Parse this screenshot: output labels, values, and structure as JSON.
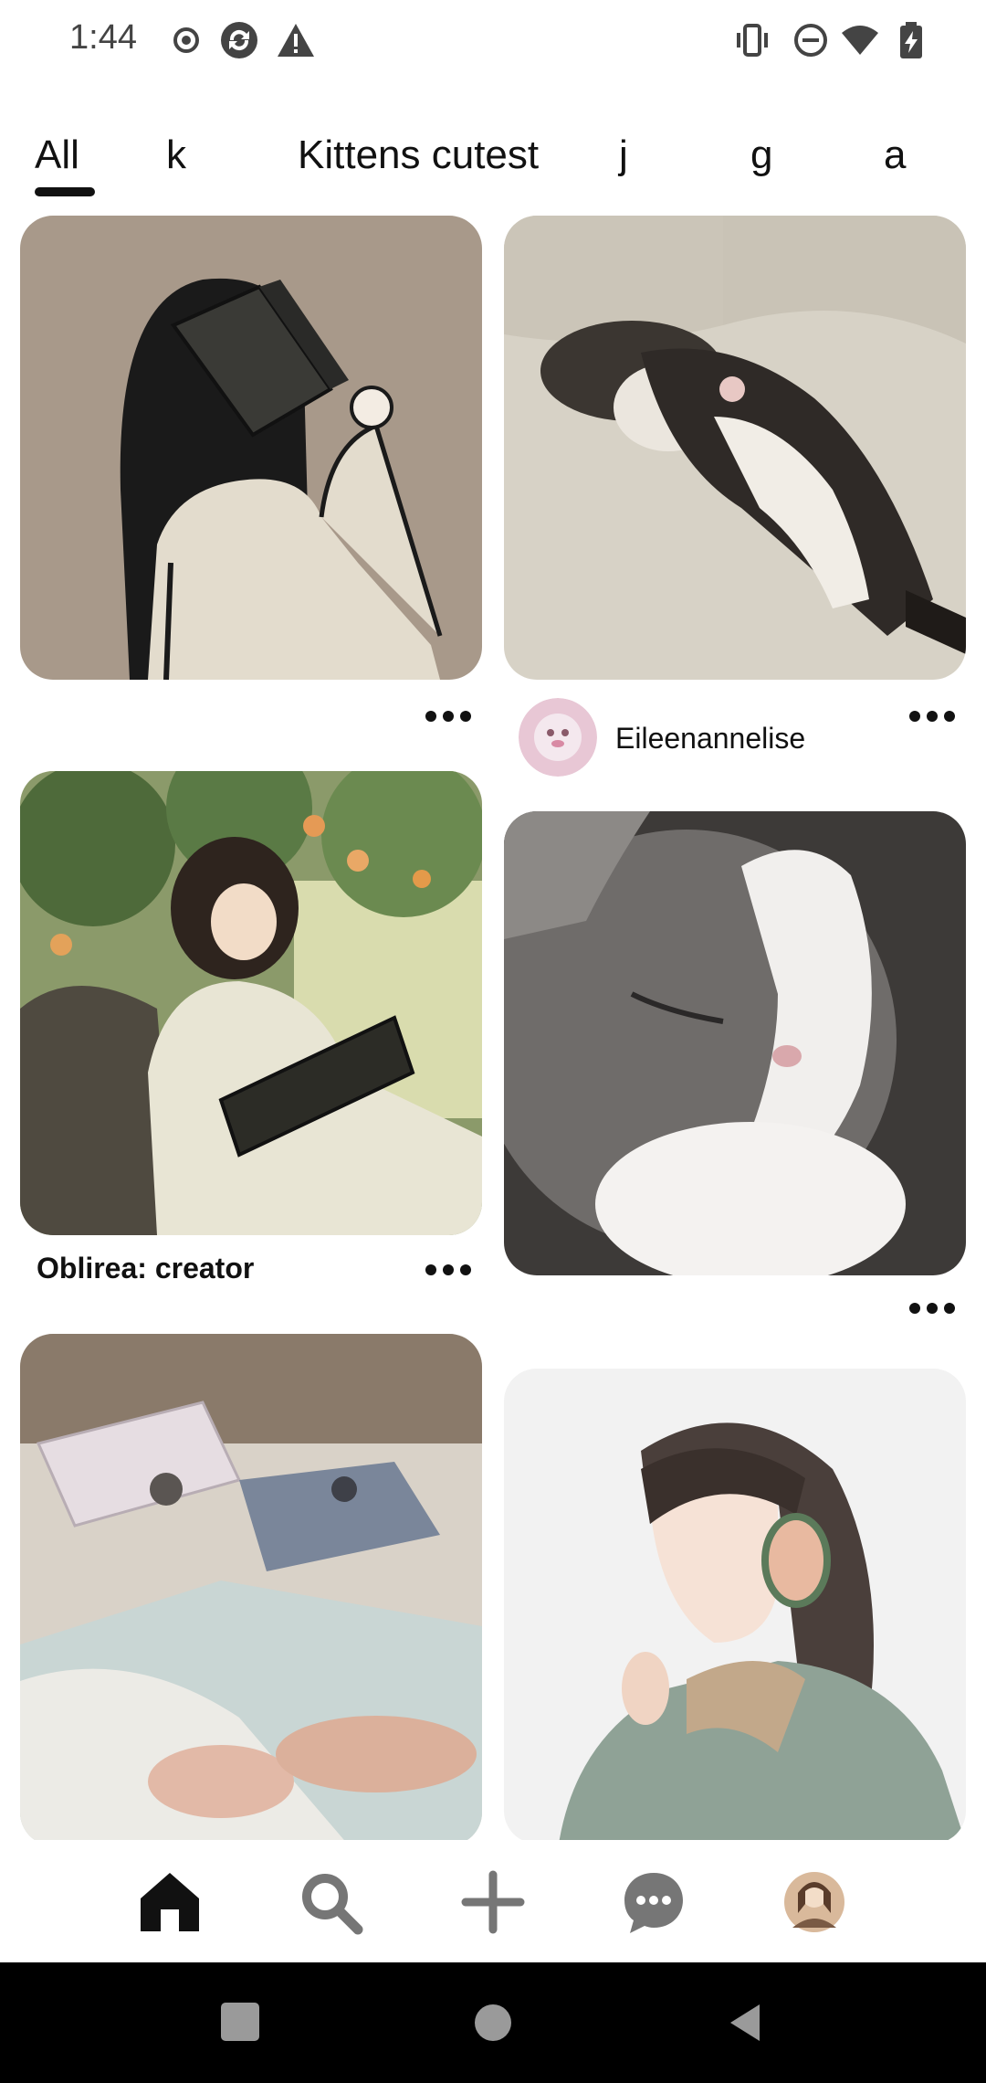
{
  "status_bar": {
    "time": "1:44",
    "left_icons": [
      "record-icon",
      "sync-icon",
      "warning-icon"
    ],
    "right_icons": [
      "vibrate-icon",
      "do-not-disturb-icon",
      "wifi-icon",
      "battery-charging-icon"
    ]
  },
  "tabs": [
    {
      "label": "All",
      "selected": true
    },
    {
      "label": "k",
      "selected": false
    },
    {
      "label": "Kittens cutest",
      "selected": false
    },
    {
      "label": "j",
      "selected": false
    },
    {
      "label": "g",
      "selected": false
    },
    {
      "label": "a",
      "selected": false
    }
  ],
  "feed": {
    "left_column": [
      {
        "image": "girl reading book illustration",
        "caption": ""
      },
      {
        "image": "girl reading under fruit tree illustration",
        "caption": "Oblirea: creator"
      },
      {
        "image": "gift wrapping photo",
        "caption": ""
      }
    ],
    "right_column": [
      {
        "image": "sleeping kitten on couch",
        "author": "Eileenannelise"
      },
      {
        "image": "grey and white cat close-up",
        "author": ""
      },
      {
        "image": "girl with headphones illustration",
        "author": ""
      }
    ]
  },
  "bottom_nav": {
    "items": [
      "home-icon",
      "search-icon",
      "create-icon",
      "messages-icon",
      "profile-avatar"
    ],
    "selected": "home"
  },
  "colors": {
    "text": "#111111",
    "background": "#ffffff",
    "system_nav": "#000000"
  }
}
